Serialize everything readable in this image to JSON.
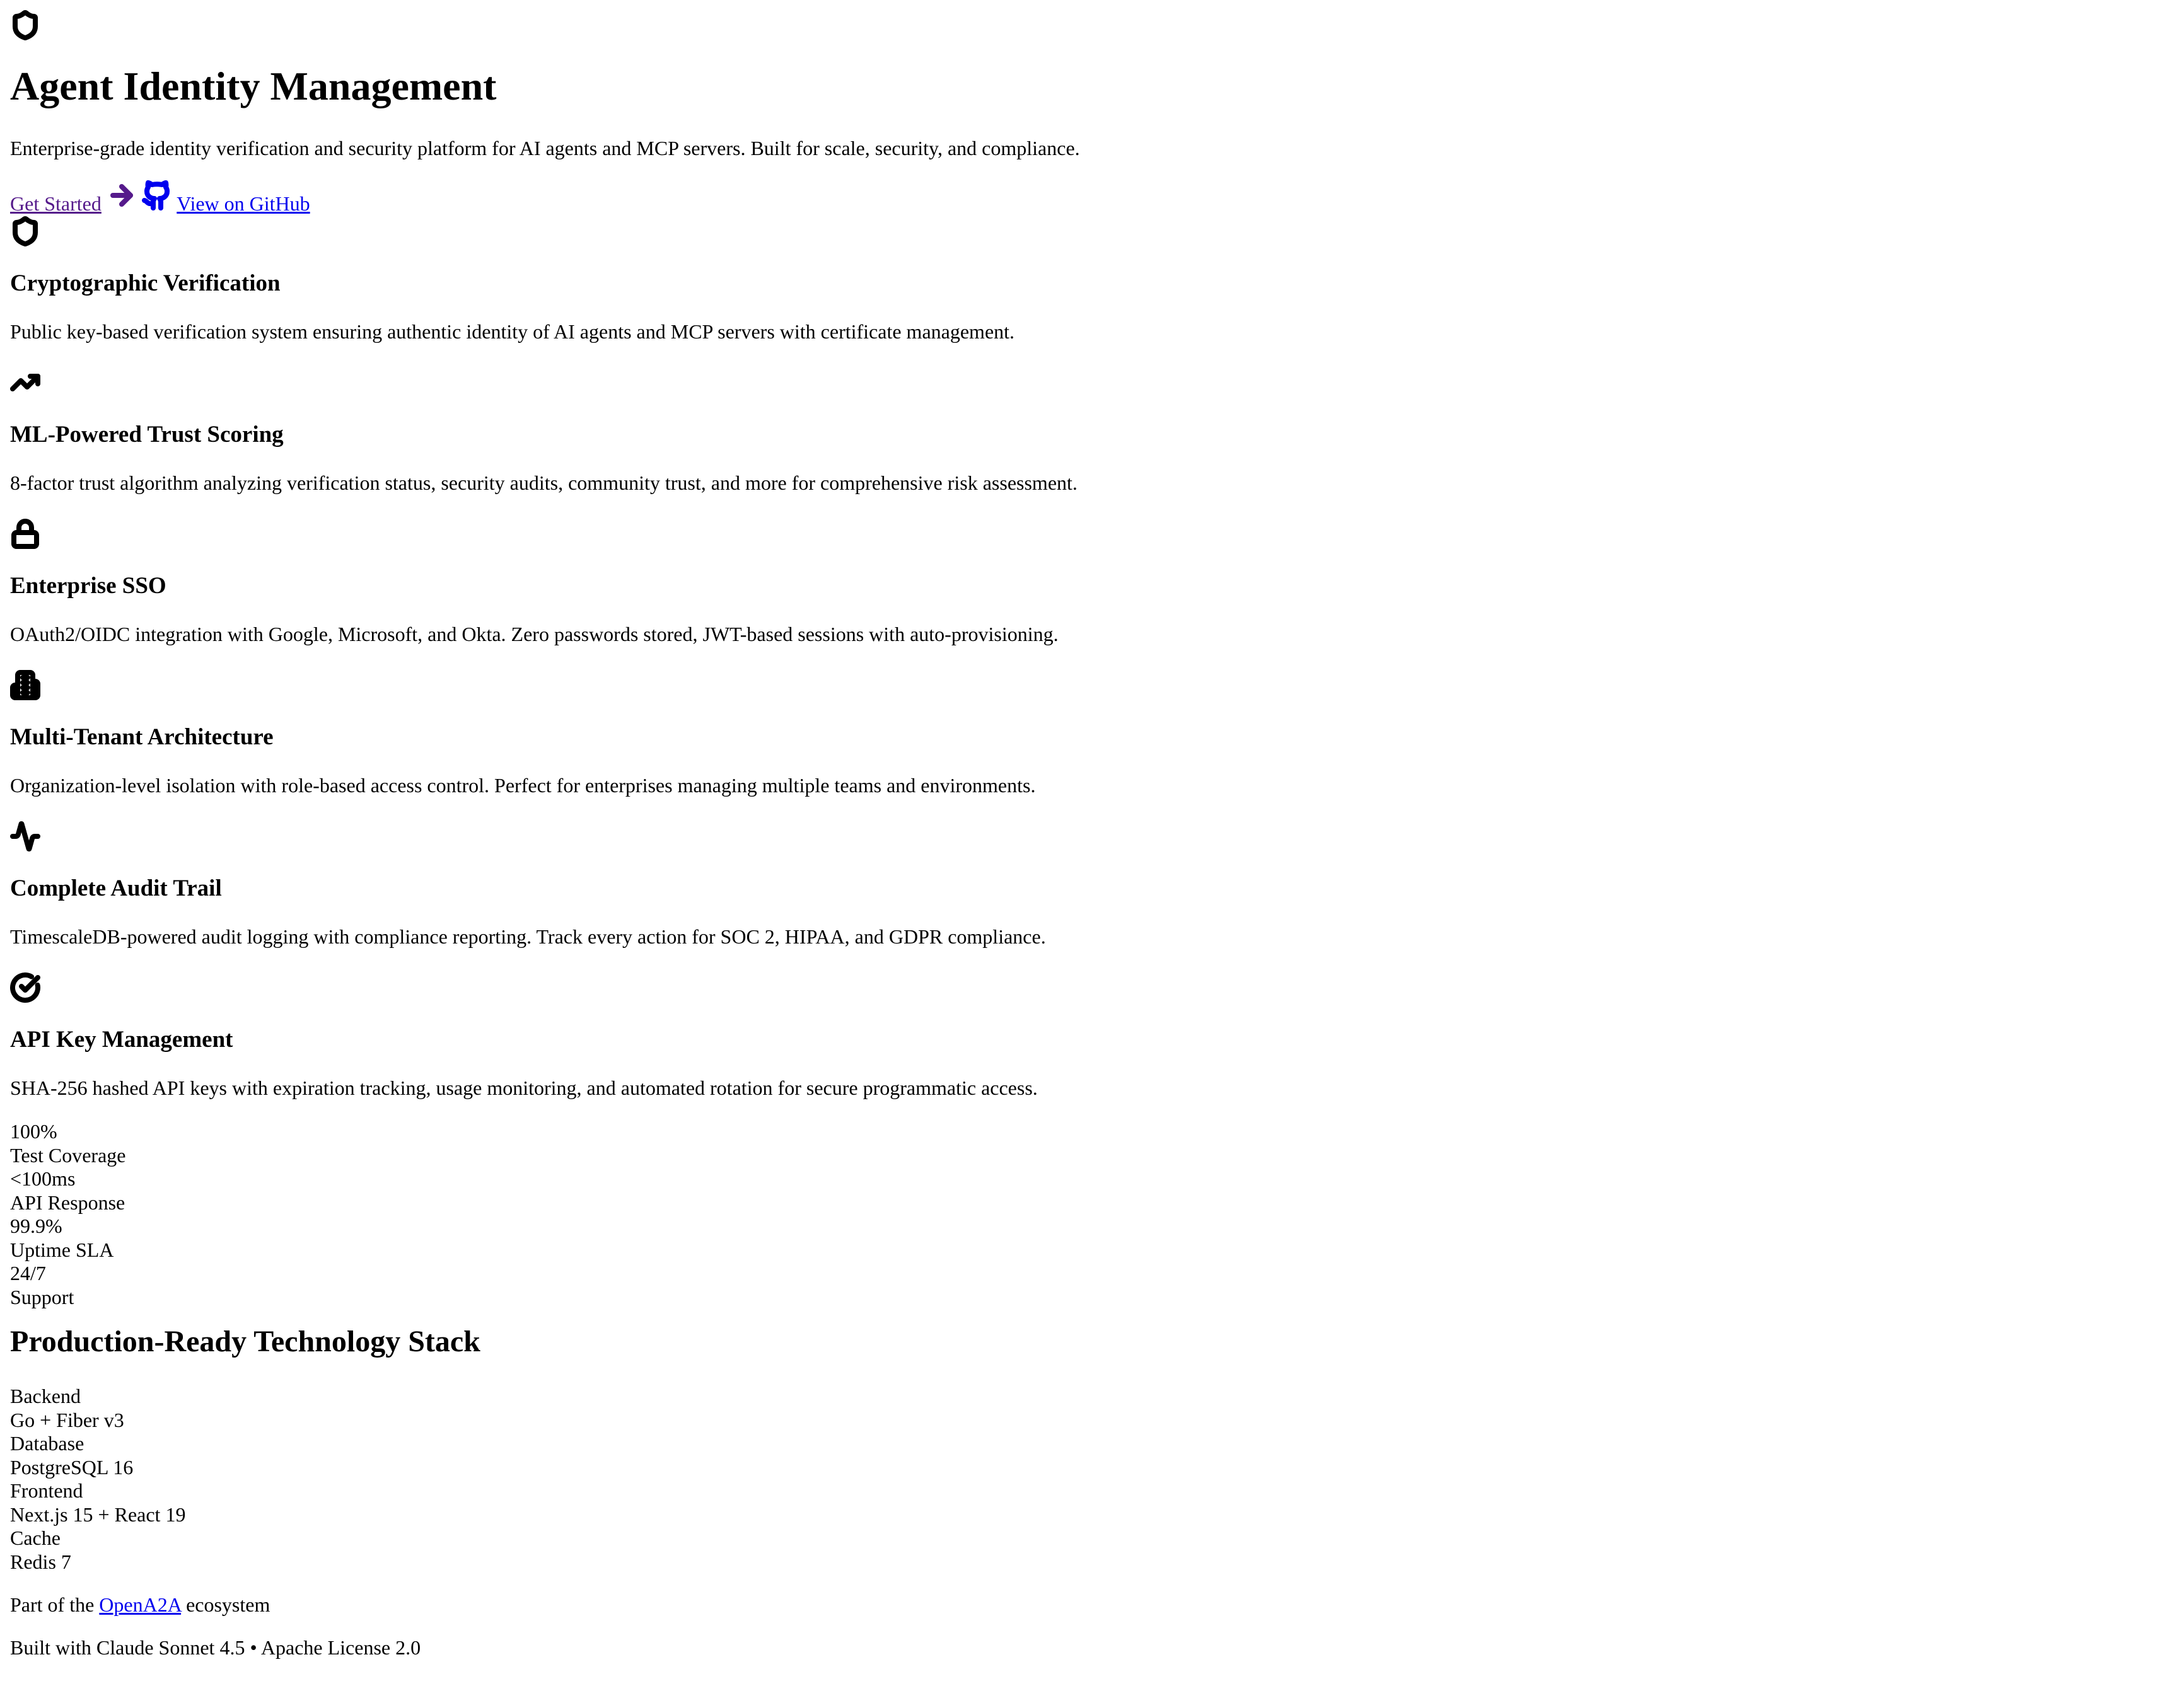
{
  "hero": {
    "icon": "shield-icon",
    "title": "Agent Identity Management",
    "subtitle": "Enterprise-grade identity verification and security platform for AI agents and MCP servers. Built for scale, security, and compliance.",
    "cta_primary": "Get Started",
    "cta_primary_icon": "arrow-right-icon",
    "cta_secondary_icon": "github-icon",
    "cta_secondary": "View on GitHub"
  },
  "features": [
    {
      "icon": "shield-icon",
      "title": "Cryptographic Verification",
      "description": "Public key-based verification system ensuring authentic identity of AI agents and MCP servers with certificate management."
    },
    {
      "icon": "trending-up-icon",
      "title": "ML-Powered Trust Scoring",
      "description": "8-factor trust algorithm analyzing verification status, security audits, community trust, and more for comprehensive risk assessment."
    },
    {
      "icon": "lock-icon",
      "title": "Enterprise SSO",
      "description": "OAuth2/OIDC integration with Google, Microsoft, and Okta. Zero passwords stored, JWT-based sessions with auto-provisioning."
    },
    {
      "icon": "building-icon",
      "title": "Multi-Tenant Architecture",
      "description": "Organization-level isolation with role-based access control. Perfect for enterprises managing multiple teams and environments."
    },
    {
      "icon": "activity-icon",
      "title": "Complete Audit Trail",
      "description": "TimescaleDB-powered audit logging with compliance reporting. Track every action for SOC 2, HIPAA, and GDPR compliance."
    },
    {
      "icon": "check-circle-icon",
      "title": "API Key Management",
      "description": "SHA-256 hashed API keys with expiration tracking, usage monitoring, and automated rotation for secure programmatic access."
    }
  ],
  "stats": [
    {
      "value": "100%",
      "label": "Test Coverage"
    },
    {
      "value": "<100ms",
      "label": "API Response"
    },
    {
      "value": "99.9%",
      "label": "Uptime SLA"
    },
    {
      "value": "24/7",
      "label": "Support"
    }
  ],
  "tech": {
    "title": "Production-Ready Technology Stack",
    "items": [
      {
        "label": "Backend",
        "value": "Go + Fiber v3"
      },
      {
        "label": "Database",
        "value": "PostgreSQL 16"
      },
      {
        "label": "Frontend",
        "value": "Next.js 15 + React 19"
      },
      {
        "label": "Cache",
        "value": "Redis 7"
      }
    ]
  },
  "footer": {
    "ecosystem_prefix": "Part of the",
    "ecosystem_link": "OpenA2A",
    "ecosystem_suffix": "ecosystem",
    "built_with": "Built with Claude Sonnet 4.5 • Apache License 2.0"
  }
}
